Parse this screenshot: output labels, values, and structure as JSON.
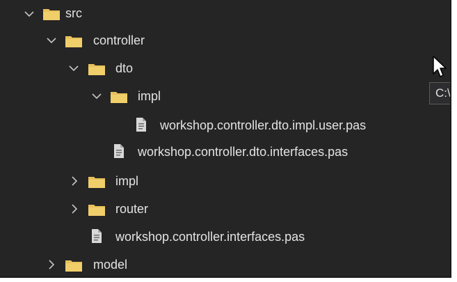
{
  "tree": {
    "items": [
      {
        "label": "src",
        "kind": "folder",
        "state": "expanded",
        "depth": 0
      },
      {
        "label": "controller",
        "kind": "folder",
        "state": "expanded",
        "depth": 1
      },
      {
        "label": "dto",
        "kind": "folder",
        "state": "expanded",
        "depth": 2
      },
      {
        "label": "impl",
        "kind": "folder",
        "state": "expanded",
        "depth": 3
      },
      {
        "label": "workshop.controller.dto.impl.user.pas",
        "kind": "file",
        "depth": 4
      },
      {
        "label": "workshop.controller.dto.interfaces.pas",
        "kind": "file",
        "depth": 3
      },
      {
        "label": "impl",
        "kind": "folder",
        "state": "collapsed",
        "depth": 2
      },
      {
        "label": "router",
        "kind": "folder",
        "state": "collapsed",
        "depth": 2
      },
      {
        "label": "workshop.controller.interfaces.pas",
        "kind": "file",
        "depth": 2
      },
      {
        "label": "model",
        "kind": "folder",
        "state": "collapsed",
        "depth": 1
      }
    ]
  },
  "tooltip": {
    "text": "C:\\"
  },
  "icons": {
    "folder": "folder-icon",
    "file": "file-icon",
    "expanded": "chevron-down-icon",
    "collapsed": "chevron-right-icon",
    "cursor": "mouse-pointer-icon"
  },
  "colors": {
    "background": "#252526",
    "text": "#e3e3e3",
    "folder": "#e8c15a",
    "chevron": "#c5c5c5",
    "file": "#d8d8d8"
  }
}
